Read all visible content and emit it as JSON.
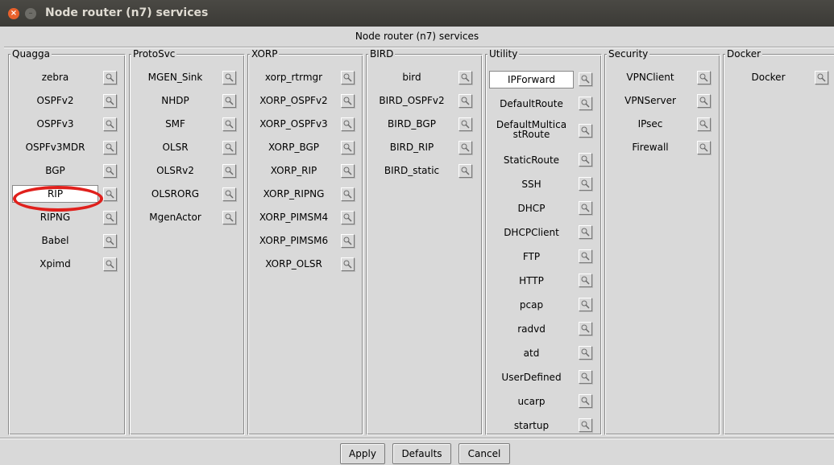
{
  "window": {
    "title": "Node router (n7) services",
    "header": "Node router (n7) services"
  },
  "groups": [
    {
      "label": "Quagga",
      "items": [
        "zebra",
        "OSPFv2",
        "OSPFv3",
        "OSPFv3MDR",
        "BGP",
        "RIP",
        "RIPNG",
        "Babel",
        "Xpimd"
      ]
    },
    {
      "label": "ProtoSvc",
      "items": [
        "MGEN_Sink",
        "NHDP",
        "SMF",
        "OLSR",
        "OLSRv2",
        "OLSRORG",
        "MgenActor"
      ]
    },
    {
      "label": "XORP",
      "items": [
        "xorp_rtrmgr",
        "XORP_OSPFv2",
        "XORP_OSPFv3",
        "XORP_BGP",
        "XORP_RIP",
        "XORP_RIPNG",
        "XORP_PIMSM4",
        "XORP_PIMSM6",
        "XORP_OLSR"
      ]
    },
    {
      "label": "BIRD",
      "items": [
        "bird",
        "BIRD_OSPFv2",
        "BIRD_BGP",
        "BIRD_RIP",
        "BIRD_static"
      ]
    },
    {
      "label": "Utility",
      "items": [
        "IPForward",
        "DefaultRoute",
        "DefaultMulticastRoute",
        "StaticRoute",
        "SSH",
        "DHCP",
        "DHCPClient",
        "FTP",
        "HTTP",
        "pcap",
        "radvd",
        "atd",
        "UserDefined",
        "ucarp",
        "startup"
      ]
    },
    {
      "label": "Security",
      "items": [
        "VPNClient",
        "VPNServer",
        "IPsec",
        "Firewall"
      ]
    },
    {
      "label": "Docker",
      "items": [
        "Docker"
      ]
    }
  ],
  "utility_multiline": {
    "line1": "DefaultMultica",
    "line2": "stRoute"
  },
  "selected": {
    "Quagga": "RIP",
    "Utility": "IPForward"
  },
  "buttons": {
    "apply": "Apply",
    "defaults": "Defaults",
    "cancel": "Cancel"
  },
  "colors": {
    "titlebar": "#3c3b37",
    "dialog_bg": "#d9d9d9",
    "highlight_ellipse": "#e0201c",
    "close_button": "#e8612c"
  }
}
